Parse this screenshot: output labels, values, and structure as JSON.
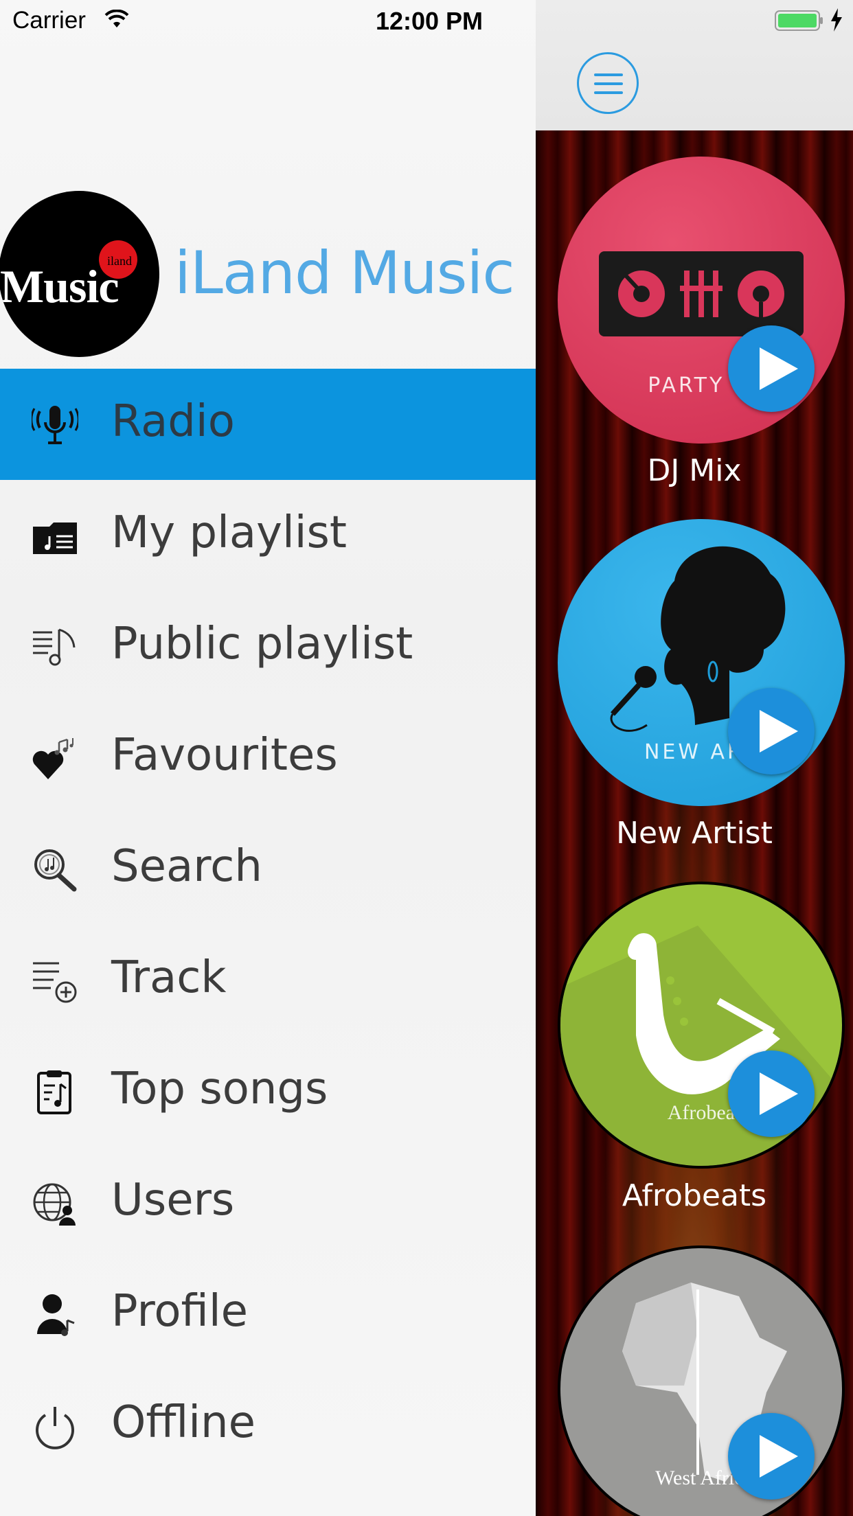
{
  "status_bar": {
    "carrier": "Carrier",
    "time": "12:00 PM"
  },
  "app": {
    "name": "iLand Music",
    "logo_word": "Music",
    "logo_small": "iland"
  },
  "menu": [
    {
      "label": "Radio",
      "icon": "radio-mic-icon",
      "active": true
    },
    {
      "label": "My playlist",
      "icon": "music-folder-icon"
    },
    {
      "label": "Public playlist",
      "icon": "playlist-note-icon"
    },
    {
      "label": "Favourites",
      "icon": "heart-note-icon"
    },
    {
      "label": "Search",
      "icon": "search-music-icon"
    },
    {
      "label": "Track",
      "icon": "track-add-icon"
    },
    {
      "label": "Top songs",
      "icon": "clipboard-note-icon"
    },
    {
      "label": "Users",
      "icon": "globe-user-icon"
    },
    {
      "label": "Profile",
      "icon": "profile-note-icon"
    },
    {
      "label": "Offline",
      "icon": "power-icon"
    }
  ],
  "channels": [
    {
      "caption": "DJ Mix",
      "art_text": "PARTY M",
      "color": "#d9365a"
    },
    {
      "caption": "New Artist",
      "art_text": "NEW ART",
      "color": "#26a6e0"
    },
    {
      "caption": "Afrobeats",
      "art_text": "Afrobeat",
      "color": "#9ac43a"
    },
    {
      "caption": "",
      "art_text": "West Africa",
      "color": "#9a9a98"
    }
  ],
  "colors": {
    "accent": "#0c94de",
    "brand_text": "#53a9e4",
    "play_button": "#1d8fdb"
  }
}
